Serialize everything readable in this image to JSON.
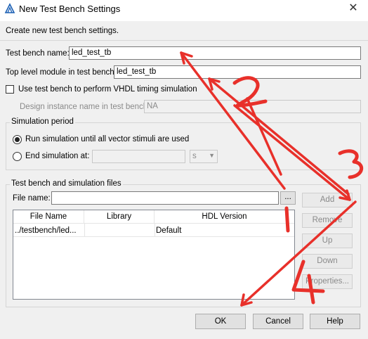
{
  "window": {
    "title": "New Test Bench Settings",
    "close_label": "✕"
  },
  "intro_text": "Create new test bench settings.",
  "test_bench_name": {
    "label": "Test bench name:",
    "value": "led_test_tb"
  },
  "top_level_module": {
    "label": "Top level module in test bench:",
    "value": "led_test_tb"
  },
  "vhdl_timing": {
    "label": "Use test bench to perform VHDL timing simulation",
    "checked": false
  },
  "design_instance": {
    "label": "Design instance name in test bench:",
    "value": "NA"
  },
  "simulation_period": {
    "title": "Simulation period",
    "run_until_label": "Run simulation until all vector stimuli are used",
    "end_at_label": "End simulation at:",
    "end_at_value": "",
    "unit_value": "s",
    "selected": "run_until"
  },
  "files_group": {
    "title": "Test bench and simulation files",
    "file_name_label": "File name:",
    "file_name_value": "",
    "browse_label": "...",
    "columns": [
      "File Name",
      "Library",
      "HDL Version"
    ],
    "rows": [
      {
        "file_name": "../testbench/led...",
        "library": "",
        "hdl_version": "Default"
      }
    ]
  },
  "side_buttons": {
    "add": "Add",
    "remove": "Remove",
    "up": "Up",
    "down": "Down",
    "properties": "Properties..."
  },
  "footer_buttons": {
    "ok": "OK",
    "cancel": "Cancel",
    "help": "Help"
  },
  "annotations": {
    "color": "#e8302a",
    "step_labels": [
      "1",
      "2",
      "3",
      "4"
    ]
  }
}
